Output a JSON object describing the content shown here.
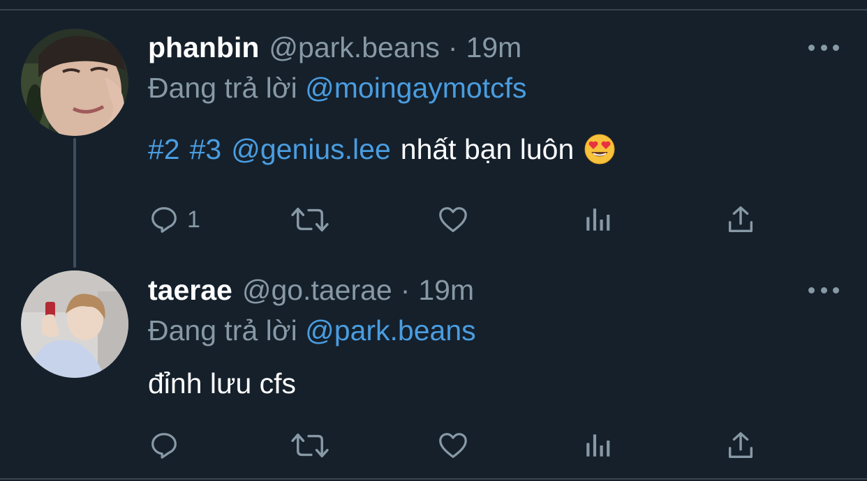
{
  "colors": {
    "background": "#15202b",
    "divider": "#38444d",
    "text_primary": "#ffffff",
    "text_secondary": "#8899a6",
    "link": "#4a9de0"
  },
  "tweets": [
    {
      "display_name": "phanbin",
      "handle": "@park.beans",
      "separator": "·",
      "time": "19m",
      "replying_prefix": "Đang trả lời",
      "replying_to": "@moingaymotcfs",
      "body": {
        "tag1": "#2",
        "tag2": "#3",
        "mention": "@genius.lee",
        "text": "nhất bạn luôn",
        "emoji": "heart-eyes-emoji"
      },
      "reply_count": "1",
      "icons": [
        "reply-icon",
        "retweet-icon",
        "like-icon",
        "analytics-icon",
        "share-icon",
        "more-icon"
      ]
    },
    {
      "display_name": "taerae",
      "handle": "@go.taerae",
      "separator": "·",
      "time": "19m",
      "replying_prefix": "Đang trả lời",
      "replying_to": "@park.beans",
      "body": {
        "text": "đỉnh lưu cfs"
      },
      "reply_count": "",
      "icons": [
        "reply-icon",
        "retweet-icon",
        "like-icon",
        "analytics-icon",
        "share-icon",
        "more-icon"
      ]
    }
  ]
}
